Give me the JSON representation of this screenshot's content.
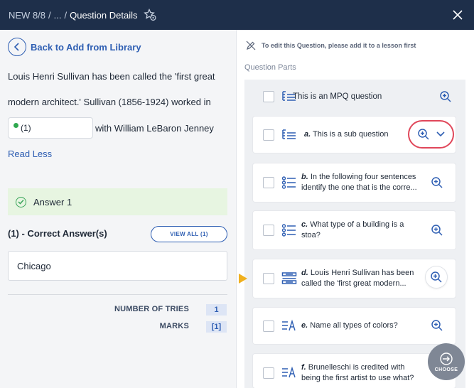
{
  "header": {
    "crumb_new": "NEW 8/8",
    "sep1": "/",
    "crumb_ellipsis": "...",
    "sep2": "/",
    "current": "Question Details",
    "star_icon": "star-settings-icon",
    "close_icon": "close-icon"
  },
  "left": {
    "back_label": "Back to Add from Library",
    "question_line1": "Louis Henri Sullivan has been called the 'first great",
    "question_line2": "modern architect.' Sullivan (1856-1924) worked in",
    "blank_value": "(1)",
    "question_line3": "with William LeBaron Jenney",
    "read_less": "Read Less",
    "answer_banner": "Answer 1",
    "correct_title": "(1) - Correct Answer(s)",
    "view_all": "VIEW ALL (1)",
    "answer_value": "Chicago",
    "tries_label": "NUMBER OF TRIES",
    "tries_value": "1",
    "marks_label": "MARKS",
    "marks_value": "[1]"
  },
  "right": {
    "edit_note": "To edit this Question, please add it to a lesson first",
    "parts_label": "Question Parts",
    "main_question": "This is an MPQ question",
    "sub_questions": [
      {
        "letter": "a.",
        "text": "This is a sub question",
        "icon": "indent-list-icon"
      },
      {
        "letter": "b.",
        "text1": "In the following four sentences",
        "text2": "identify the one that is the corre...",
        "icon": "bullet-list-icon"
      },
      {
        "letter": "c.",
        "text1": "What type of a building is a",
        "text2": "stoa?",
        "icon": "bullet-list-icon"
      },
      {
        "letter": "d.",
        "text1": "Louis Henri Sullivan has been",
        "text2": "called the 'first great modern...",
        "icon": "fill-blank-icon"
      },
      {
        "letter": "e.",
        "text": "Name all types of colors?",
        "icon": "text-answer-icon"
      },
      {
        "letter": "f.",
        "text1": "Brunelleschi is credited with",
        "text2": "being the first artist to use what?",
        "icon": "text-answer-icon"
      }
    ],
    "choose_label": "CHOOSE"
  },
  "colors": {
    "header_bg": "#1e2f4a",
    "accent_blue": "#2f5fb3",
    "highlight_red": "#e0475a",
    "pointer_yellow": "#f0b01e",
    "answer_green_bg": "#e7f5e1"
  }
}
